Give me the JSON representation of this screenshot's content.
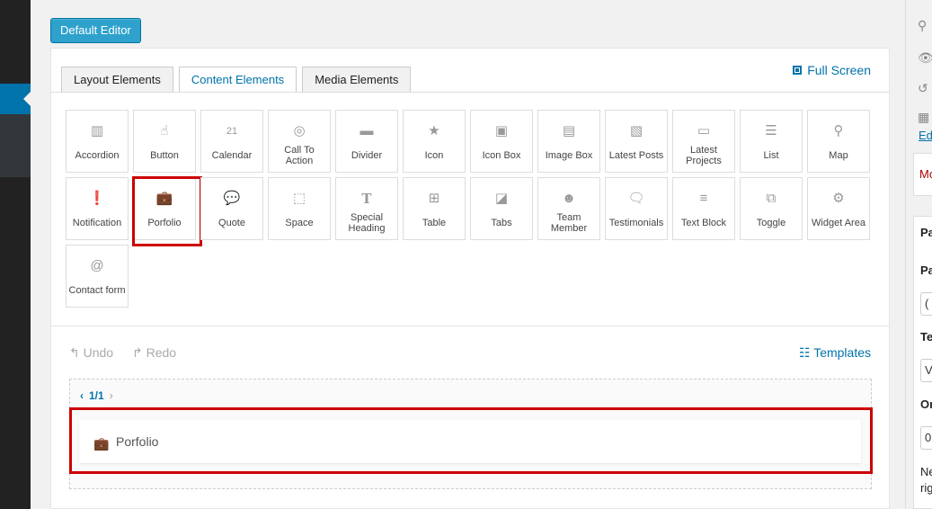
{
  "toolbar": {
    "default_editor_label": "Default Editor"
  },
  "tabs": [
    {
      "label": "Layout Elements",
      "active": false
    },
    {
      "label": "Content Elements",
      "active": true
    },
    {
      "label": "Media Elements",
      "active": false
    }
  ],
  "full_screen_label": "Full Screen",
  "elements": [
    {
      "label": "Accordion",
      "icon": "book-icon"
    },
    {
      "label": "Button",
      "icon": "pointer-hand-icon"
    },
    {
      "label": "Calendar",
      "icon": "calendar-icon"
    },
    {
      "label": "Call To Action",
      "icon": "target-icon"
    },
    {
      "label": "Divider",
      "icon": "divider-icon"
    },
    {
      "label": "Icon",
      "icon": "star-icon"
    },
    {
      "label": "Icon Box",
      "icon": "icon-box-icon"
    },
    {
      "label": "Image Box",
      "icon": "image-box-icon"
    },
    {
      "label": "Latest Posts",
      "icon": "posts-icon"
    },
    {
      "label": "Latest Projects",
      "icon": "monitor-icon"
    },
    {
      "label": "List",
      "icon": "list-icon"
    },
    {
      "label": "Map",
      "icon": "map-pin-icon"
    },
    {
      "label": "Notification",
      "icon": "exclamation-icon"
    },
    {
      "label": "Porfolio",
      "icon": "briefcase-icon"
    },
    {
      "label": "Quote",
      "icon": "speech-bubble-icon"
    },
    {
      "label": "Space",
      "icon": "space-icon"
    },
    {
      "label": "Special Heading",
      "icon": "text-t-icon"
    },
    {
      "label": "Table",
      "icon": "table-icon"
    },
    {
      "label": "Tabs",
      "icon": "tabs-icon"
    },
    {
      "label": "Team Member",
      "icon": "person-icon"
    },
    {
      "label": "Testimonials",
      "icon": "testimonial-icon"
    },
    {
      "label": "Text Block",
      "icon": "text-lines-icon"
    },
    {
      "label": "Toggle",
      "icon": "toggle-icon"
    },
    {
      "label": "Widget Area",
      "icon": "gear-icon"
    },
    {
      "label": "Contact form",
      "icon": "at-sign-icon"
    }
  ],
  "history": {
    "undo_label": "Undo",
    "redo_label": "Redo"
  },
  "templates_label": "Templates",
  "pager": {
    "text": "1/1"
  },
  "added_element": {
    "label": "Porfolio",
    "icon": "briefcase-icon"
  },
  "sidebar": {
    "edit_link": "Ed",
    "move_text": "Mo",
    "section_title": "Pa",
    "label_1": "Pa",
    "select_1": "(",
    "label_2": "Te",
    "select_2": "V",
    "label_3": "Or",
    "input_3": "0",
    "note_1": "Ne",
    "note_2": "rig"
  },
  "colors": {
    "accent": "#0073aa",
    "highlight": "#cc0000",
    "button": "#2ea2cc"
  }
}
